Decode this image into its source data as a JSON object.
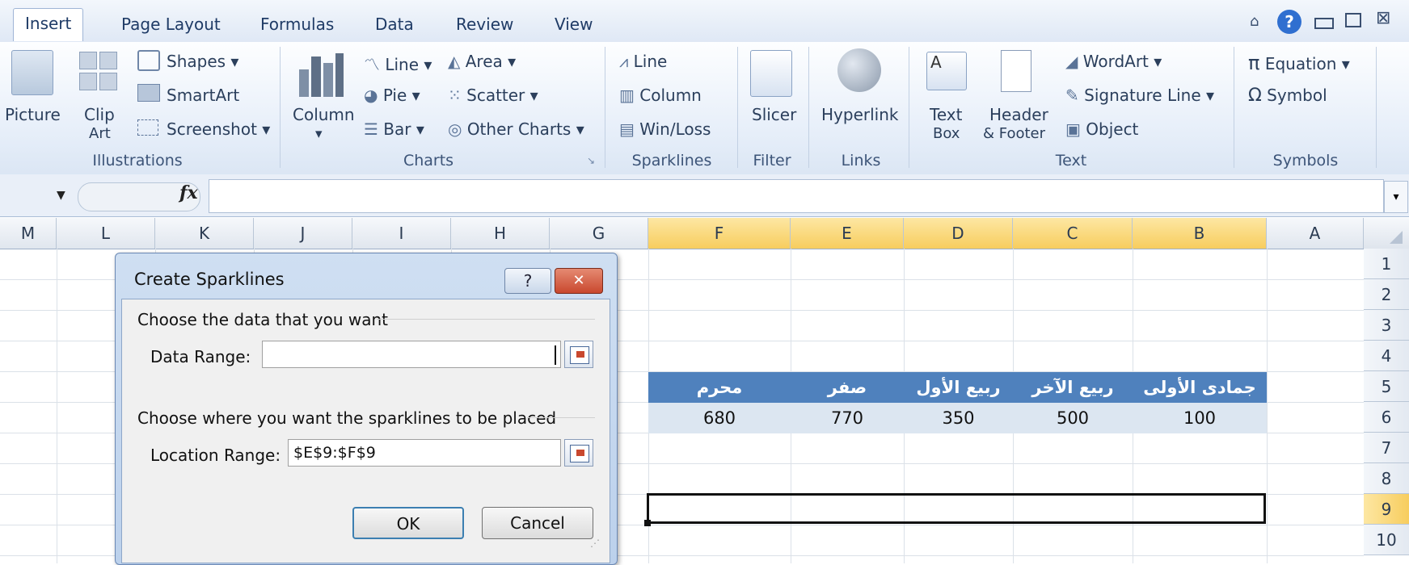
{
  "ribbon": {
    "tabs": [
      "Insert",
      "Page Layout",
      "Formulas",
      "Data",
      "Review",
      "View"
    ],
    "active_tab": "Insert",
    "groups": {
      "illustrations": {
        "label": "Illustrations",
        "picture": "Picture",
        "clip_art": [
          "Clip",
          "Art"
        ],
        "shapes": "Shapes",
        "smartart": "SmartArt",
        "screenshot": "Screenshot"
      },
      "charts": {
        "label": "Charts",
        "column": "Column",
        "line": "Line",
        "area": "Area",
        "pie": "Pie",
        "scatter": "Scatter",
        "bar": "Bar",
        "other": "Other Charts"
      },
      "sparklines": {
        "label": "Sparklines",
        "line": "Line",
        "column": "Column",
        "winloss": "Win/Loss"
      },
      "filter": {
        "label": "Filter",
        "slicer": "Slicer"
      },
      "links": {
        "label": "Links",
        "hyperlink": "Hyperlink"
      },
      "text": {
        "label": "Text",
        "textbox": [
          "Text",
          "Box"
        ],
        "header": [
          "Header",
          "& Footer"
        ],
        "wordart": "WordArt",
        "signature": "Signature Line",
        "object": "Object"
      },
      "symbols": {
        "label": "Symbols",
        "equation": "Equation",
        "symbol": "Symbol"
      }
    }
  },
  "formula_bar": {
    "fx": "fx",
    "value": ""
  },
  "sheet": {
    "columns": [
      "M",
      "L",
      "K",
      "J",
      "I",
      "H",
      "G",
      "F",
      "E",
      "D",
      "C",
      "B",
      "A"
    ],
    "rows": [
      "1",
      "2",
      "3",
      "4",
      "5",
      "6",
      "7",
      "8",
      "9",
      "10"
    ],
    "selected_row": "9",
    "table_headers": [
      "محرم",
      "صفر",
      "ربيع الأول",
      "ربيع الآخر",
      "جمادى الأولى"
    ],
    "table_values": [
      "680",
      "770",
      "350",
      "500",
      "100"
    ]
  },
  "dialog": {
    "title": "Create Sparklines",
    "help": "?",
    "close": "✕",
    "section1": "Choose the data that you want",
    "data_range_label": "Data Range:",
    "data_range_value": "",
    "section2": "Choose where you want the sparklines to be placed",
    "location_label": "Location Range:",
    "location_value": "$E$9:$F$9",
    "ok": "OK",
    "cancel": "Cancel"
  },
  "colors": {
    "table_header": "#4f81bd",
    "table_band": "#dce6f1",
    "selection_header": "#f7cd5e",
    "close_button": "#c9482e"
  }
}
